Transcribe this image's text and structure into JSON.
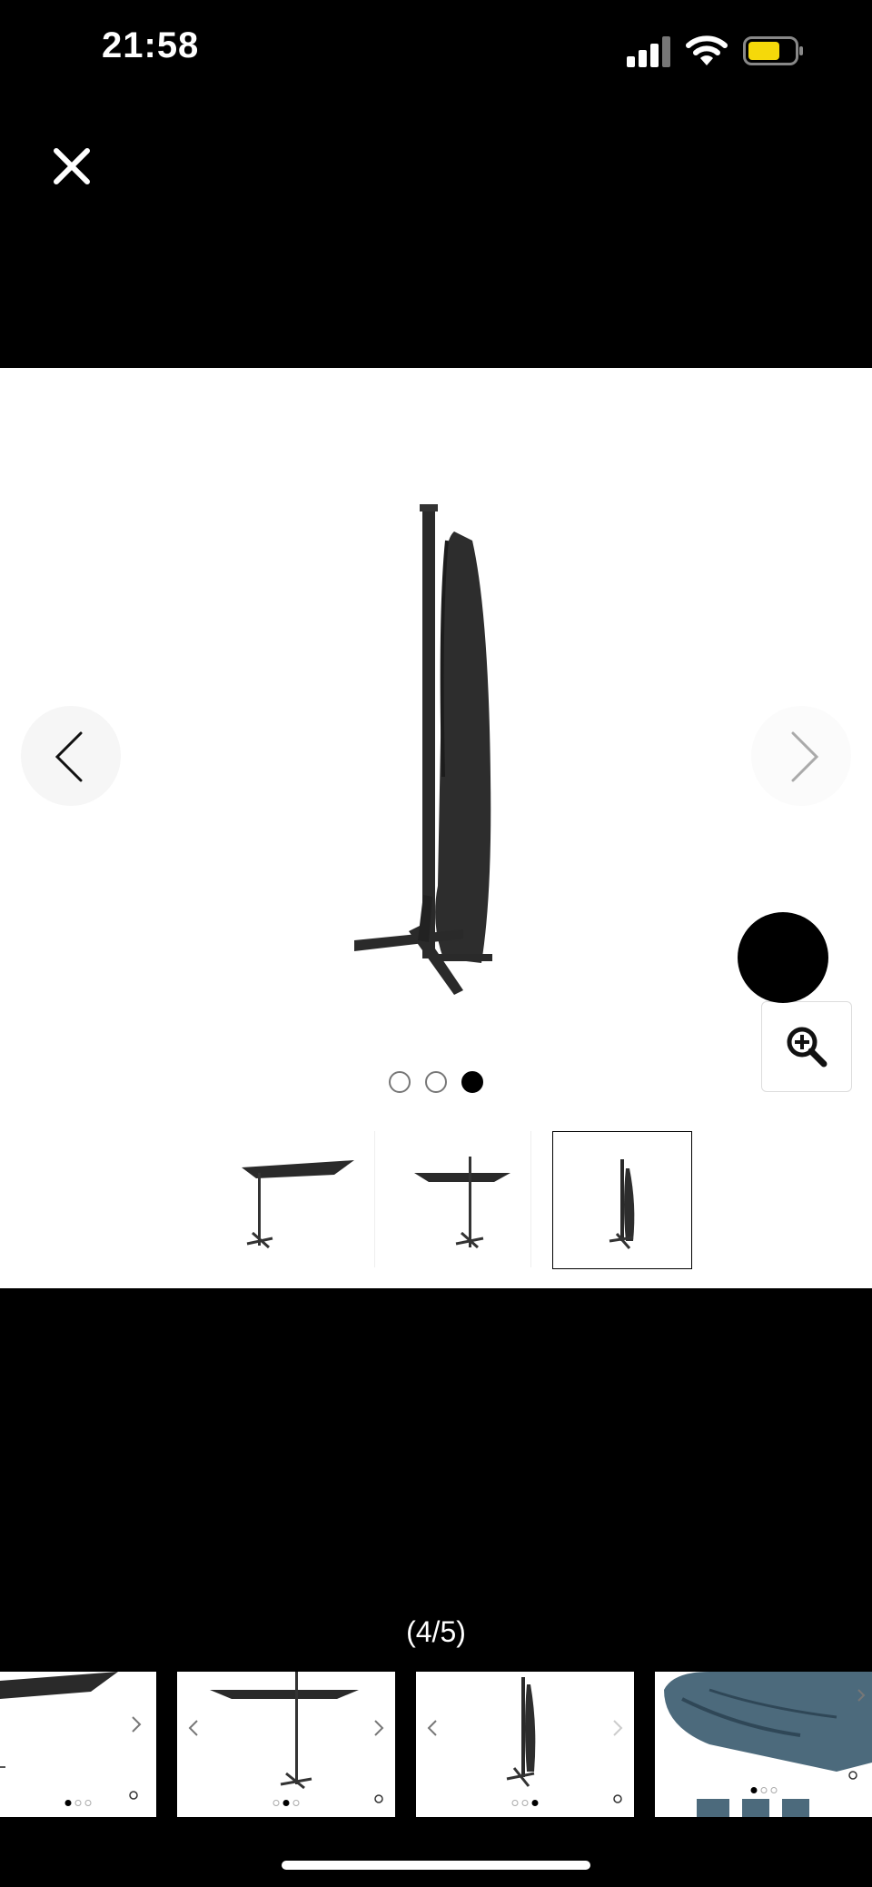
{
  "status_bar": {
    "time": "21:58"
  },
  "gallery": {
    "counter": "(4/5)",
    "carousel_current_index": 3,
    "carousel_total": 3
  },
  "colors": {
    "background": "#000000",
    "viewer_bg": "#ffffff",
    "battery": "#f5d90a",
    "active_dot": "#000000"
  },
  "icons": [
    "close-icon",
    "chevron-left-icon",
    "chevron-right-icon",
    "zoom-in-icon",
    "signal-icon",
    "wifi-icon",
    "battery-icon"
  ]
}
